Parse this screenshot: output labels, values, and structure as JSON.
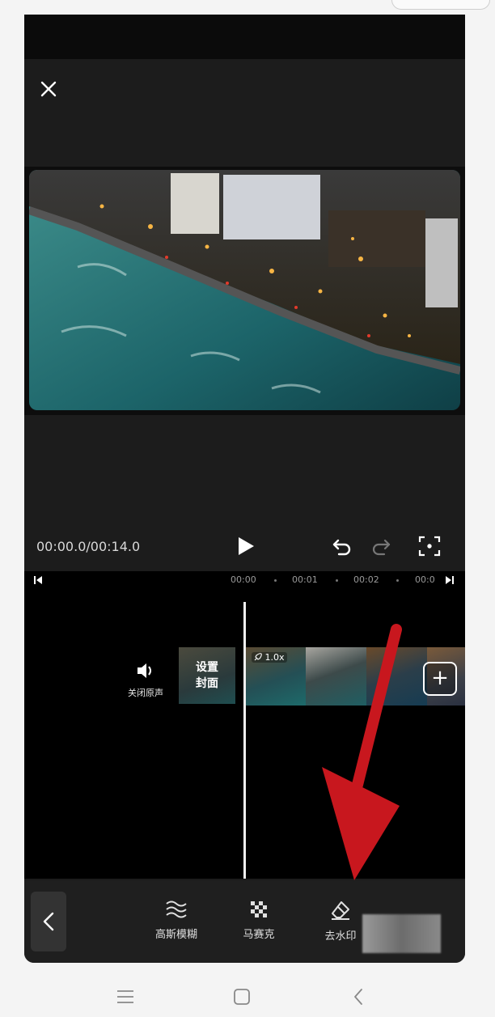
{
  "player": {
    "timecode": "00:00.0/00:14.0"
  },
  "timeline": {
    "ruler_labels": [
      "00:00",
      "00:01",
      "00:02",
      "00:0"
    ],
    "mute_label": "关闭原声",
    "cover_label_line1": "设置",
    "cover_label_line2": "封面",
    "clip_speed": "1.0x",
    "add_label": "+"
  },
  "toolbar": {
    "items": [
      {
        "label": "高斯模糊",
        "icon": "wave-blur-icon"
      },
      {
        "label": "马赛克",
        "icon": "mosaic-icon"
      },
      {
        "label": "去水印",
        "icon": "eraser-icon"
      }
    ]
  },
  "colors": {
    "annotation_arrow": "#c8171e",
    "editor_bg": "#1c1c1c",
    "timeline_bg": "#000000"
  }
}
